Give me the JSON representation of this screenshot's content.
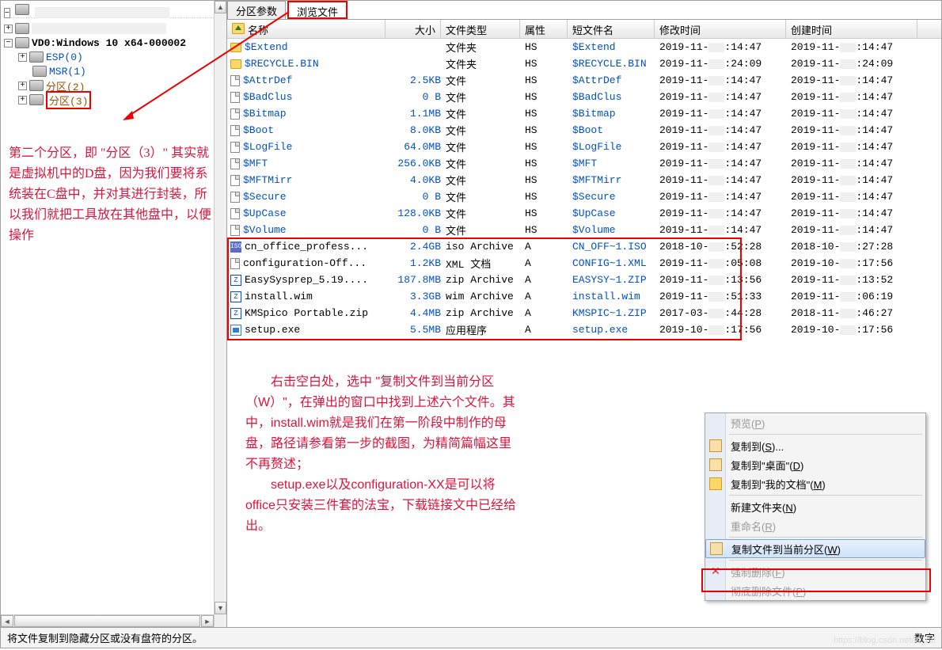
{
  "tabs": {
    "params": "分区参数",
    "browse": "浏览文件"
  },
  "tree": {
    "root": "VD0:Windows 10 x64-000002",
    "children": [
      "ESP(0)",
      "MSR(1)",
      "分区(2)",
      "分区(3)"
    ]
  },
  "columns": {
    "name": "名称",
    "size": "大小",
    "type": "文件类型",
    "attr": "属性",
    "short": "短文件名",
    "mtime": "修改时间",
    "ctime": "创建时间"
  },
  "files": [
    {
      "n": "$Extend",
      "s": "",
      "t": "文件夹",
      "a": "HS",
      "sh": "$Extend",
      "m1": "2019-11-",
      "m2": ":14:47",
      "c1": "2019-11-",
      "c2": ":14:47",
      "ic": "folder",
      "sys": true
    },
    {
      "n": "$RECYCLE.BIN",
      "s": "",
      "t": "文件夹",
      "a": "HS",
      "sh": "$RECYCLE.BIN",
      "m1": "2019-11-",
      "m2": ":24:09",
      "c1": "2019-11-",
      "c2": ":24:09",
      "ic": "folder",
      "sys": true
    },
    {
      "n": "$AttrDef",
      "s": "2.5KB",
      "t": "文件",
      "a": "HS",
      "sh": "$AttrDef",
      "m1": "2019-11-",
      "m2": ":14:47",
      "c1": "2019-11-",
      "c2": ":14:47",
      "ic": "file",
      "sys": true
    },
    {
      "n": "$BadClus",
      "s": "0 B",
      "t": "文件",
      "a": "HS",
      "sh": "$BadClus",
      "m1": "2019-11-",
      "m2": ":14:47",
      "c1": "2019-11-",
      "c2": ":14:47",
      "ic": "file",
      "sys": true
    },
    {
      "n": "$Bitmap",
      "s": "1.1MB",
      "t": "文件",
      "a": "HS",
      "sh": "$Bitmap",
      "m1": "2019-11-",
      "m2": ":14:47",
      "c1": "2019-11-",
      "c2": ":14:47",
      "ic": "file",
      "sys": true
    },
    {
      "n": "$Boot",
      "s": "8.0KB",
      "t": "文件",
      "a": "HS",
      "sh": "$Boot",
      "m1": "2019-11-",
      "m2": ":14:47",
      "c1": "2019-11-",
      "c2": ":14:47",
      "ic": "file",
      "sys": true
    },
    {
      "n": "$LogFile",
      "s": "64.0MB",
      "t": "文件",
      "a": "HS",
      "sh": "$LogFile",
      "m1": "2019-11-",
      "m2": ":14:47",
      "c1": "2019-11-",
      "c2": ":14:47",
      "ic": "file",
      "sys": true
    },
    {
      "n": "$MFT",
      "s": "256.0KB",
      "t": "文件",
      "a": "HS",
      "sh": "$MFT",
      "m1": "2019-11-",
      "m2": ":14:47",
      "c1": "2019-11-",
      "c2": ":14:47",
      "ic": "file",
      "sys": true
    },
    {
      "n": "$MFTMirr",
      "s": "4.0KB",
      "t": "文件",
      "a": "HS",
      "sh": "$MFTMirr",
      "m1": "2019-11-",
      "m2": ":14:47",
      "c1": "2019-11-",
      "c2": ":14:47",
      "ic": "file",
      "sys": true
    },
    {
      "n": "$Secure",
      "s": "0 B",
      "t": "文件",
      "a": "HS",
      "sh": "$Secure",
      "m1": "2019-11-",
      "m2": ":14:47",
      "c1": "2019-11-",
      "c2": ":14:47",
      "ic": "file",
      "sys": true
    },
    {
      "n": "$UpCase",
      "s": "128.0KB",
      "t": "文件",
      "a": "HS",
      "sh": "$UpCase",
      "m1": "2019-11-",
      "m2": ":14:47",
      "c1": "2019-11-",
      "c2": ":14:47",
      "ic": "file",
      "sys": true
    },
    {
      "n": "$Volume",
      "s": "0 B",
      "t": "文件",
      "a": "HS",
      "sh": "$Volume",
      "m1": "2019-11-",
      "m2": ":14:47",
      "c1": "2019-11-",
      "c2": ":14:47",
      "ic": "file",
      "sys": true
    },
    {
      "n": "cn_office_profess...",
      "s": "2.4GB",
      "t": "iso Archive",
      "a": "A",
      "sh": "CN_OFF~1.ISO",
      "m1": "2018-10-",
      "m2": ":52:28",
      "c1": "2018-10-",
      "c2": ":27:28",
      "ic": "iso"
    },
    {
      "n": "configuration-Off...",
      "s": "1.2KB",
      "t": "XML 文档",
      "a": "A",
      "sh": "CONFIG~1.XML",
      "m1": "2019-11-",
      "m2": ":05:08",
      "c1": "2019-10-",
      "c2": ":17:56",
      "ic": "file"
    },
    {
      "n": "EasySysprep_5.19....",
      "s": "187.8MB",
      "t": "zip Archive",
      "a": "A",
      "sh": "EASYSY~1.ZIP",
      "m1": "2019-11-",
      "m2": ":13:56",
      "c1": "2019-11-",
      "c2": ":13:52",
      "ic": "zip"
    },
    {
      "n": "install.wim",
      "s": "3.3GB",
      "t": "wim Archive",
      "a": "A",
      "sh": "install.wim",
      "m1": "2019-11-",
      "m2": ":51:33",
      "c1": "2019-11-",
      "c2": ":06:19",
      "ic": "zip"
    },
    {
      "n": "KMSpico Portable.zip",
      "s": "4.4MB",
      "t": "zip Archive",
      "a": "A",
      "sh": "KMSPIC~1.ZIP",
      "m1": "2017-03-",
      "m2": ":44:28",
      "c1": "2018-11-",
      "c2": ":46:27",
      "ic": "zip"
    },
    {
      "n": "setup.exe",
      "s": "5.5MB",
      "t": "应用程序",
      "a": "A",
      "sh": "setup.exe",
      "m1": "2019-10-",
      "m2": ":17:56",
      "c1": "2019-10-",
      "c2": ":17:56",
      "ic": "exe"
    }
  ],
  "context_menu": {
    "preview": "预览(P)",
    "copy_to": "复制到(S)...",
    "copy_desktop": "复制到\"桌面\"(D)",
    "copy_docs": "复制到\"我的文档\"(M)",
    "new_folder": "新建文件夹(N)",
    "rename": "重命名(R)",
    "copy_partition": "复制文件到当前分区(W)",
    "force_delete": "强制删除(F)",
    "delete_complete": "彻底删除文件(P)"
  },
  "annotations": {
    "left": "第二个分区，即 \"分区（3）\" 其实就是虚拟机中的D盘，因为我们要将系统装在C盘中，并对其进行封装，所以我们就把工具放在其他盘中，以便操作",
    "right": "　　右击空白处，选中 \"复制文件到当前分区（W）\"，在弹出的窗口中找到上述六个文件。其中，install.wim就是我们在第一阶段中制作的母盘，路径请参看第一步的截图，为精简篇幅这里不再赘述；\n　　setup.exe以及configuration-XX是可以将office只安装三件套的法宝，下载链接文中已经给出。"
  },
  "status": {
    "text": "将文件复制到隐藏分区或没有盘符的分区。",
    "right": "数字"
  }
}
